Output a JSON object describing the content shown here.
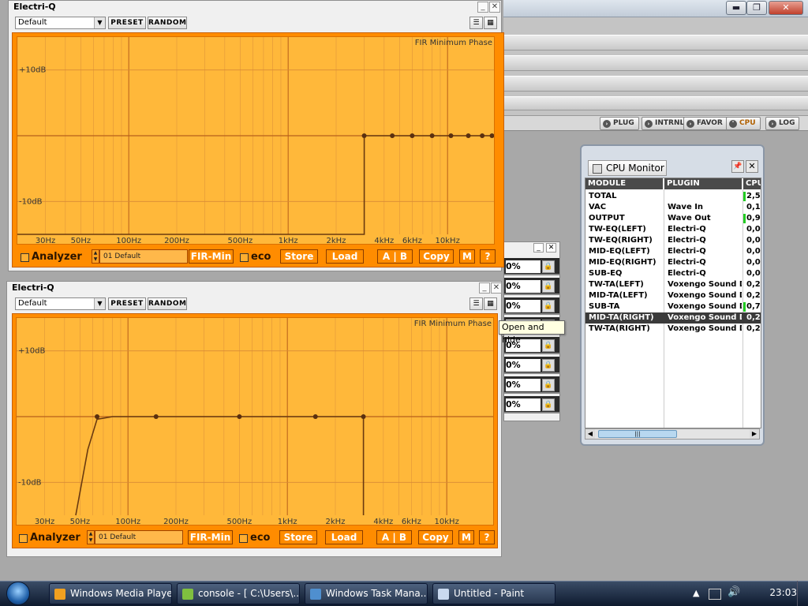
{
  "host": {
    "window_buttons": [
      "▬",
      "❐",
      "✕"
    ],
    "nav": [
      {
        "label": "PLUG",
        "icon": "arrow-icon"
      },
      {
        "label": "INTRNL",
        "icon": "arrow-icon"
      },
      {
        "label": "FAVOR",
        "icon": "arrow-icon"
      },
      {
        "label": "CPU",
        "icon": "down-arrow-icon",
        "active": true
      },
      {
        "label": "LOG",
        "icon": "arrow-icon"
      }
    ]
  },
  "eq1": {
    "title": "Electri-Q",
    "preset": "Default",
    "preset_btn": "PRESET",
    "random_btn": "RANDOM",
    "phase": "FIR Minimum Phase",
    "analyzer": "Analyzer",
    "program": "01  Default",
    "firmin": "FIR-Min",
    "eco": "eco",
    "store": "Store",
    "load": "Load",
    "ab": "A | B",
    "copy": "Copy",
    "m": "M",
    "help": "?"
  },
  "eq2": {
    "title": "Electri-Q",
    "preset": "Default",
    "preset_btn": "PRESET",
    "random_btn": "RANDOM",
    "phase": "FIR Minimum Phase",
    "analyzer": "Analyzer",
    "program": "01  Default",
    "firmin": "FIR-Min",
    "eco": "eco",
    "store": "Store",
    "load": "Load",
    "ab": "A | B",
    "copy": "Copy",
    "m": "M",
    "help": "?"
  },
  "chart_data": [
    {
      "type": "line",
      "title": "",
      "y_labels": [
        "+10dB",
        "-10dB"
      ],
      "x_labels": [
        "30Hz",
        "50Hz",
        "100Hz",
        "200Hz",
        "500Hz",
        "1kHz",
        "2kHz",
        "4kHz",
        "6kHz",
        "10kHz"
      ],
      "x_scale": "log",
      "xlim": [
        20,
        20000
      ],
      "ylim": [
        -15,
        15
      ],
      "grid": true,
      "curve": [
        [
          20,
          -15
        ],
        [
          3000,
          -15
        ],
        [
          3000,
          0
        ],
        [
          20000,
          0
        ]
      ],
      "points": [
        [
          3000,
          0
        ],
        [
          4500,
          0
        ],
        [
          6000,
          0
        ],
        [
          8000,
          0
        ],
        [
          10500,
          0
        ],
        [
          13500,
          0
        ],
        [
          16500,
          0
        ],
        [
          19000,
          0
        ]
      ]
    },
    {
      "type": "line",
      "title": "",
      "y_labels": [
        "+10dB",
        "-10dB"
      ],
      "x_labels": [
        "30Hz",
        "50Hz",
        "100Hz",
        "200Hz",
        "500Hz",
        "1kHz",
        "2kHz",
        "4kHz",
        "6kHz",
        "10kHz"
      ],
      "x_scale": "log",
      "xlim": [
        20,
        20000
      ],
      "ylim": [
        -15,
        15
      ],
      "grid": true,
      "curve": [
        [
          47,
          -15
        ],
        [
          56,
          -5
        ],
        [
          64,
          -0.4
        ],
        [
          80,
          0
        ],
        [
          3000,
          0
        ],
        [
          3000,
          -15
        ]
      ],
      "points": [
        [
          64,
          0
        ],
        [
          150,
          0
        ],
        [
          500,
          0
        ],
        [
          1500,
          0
        ],
        [
          3000,
          0
        ]
      ]
    }
  ],
  "tooltip": "Open and hide",
  "mid_window": {
    "rows": [
      "0%",
      "0%",
      "0%",
      "0%",
      "0%",
      "0%",
      "0%",
      "0%"
    ]
  },
  "cpu_monitor": {
    "title": "CPU Monitor",
    "headers": [
      "MODULE",
      "PLUGIN",
      "CPU"
    ],
    "rows": [
      {
        "module": "TOTAL",
        "plugin": "",
        "cpu": "2,5",
        "bar": true
      },
      {
        "module": "VAC",
        "plugin": "Wave In",
        "cpu": "0,1"
      },
      {
        "module": "OUTPUT",
        "plugin": "Wave Out",
        "cpu": "0,9",
        "bar": true
      },
      {
        "module": "TW-EQ(LEFT)",
        "plugin": "Electri-Q",
        "cpu": "0,0"
      },
      {
        "module": "TW-EQ(RIGHT)",
        "plugin": "Electri-Q",
        "cpu": "0,0"
      },
      {
        "module": "MID-EQ(LEFT)",
        "plugin": "Electri-Q",
        "cpu": "0,0"
      },
      {
        "module": "MID-EQ(RIGHT)",
        "plugin": "Electri-Q",
        "cpu": "0,0"
      },
      {
        "module": "SUB-EQ",
        "plugin": "Electri-Q",
        "cpu": "0,0"
      },
      {
        "module": "TW-TA(LEFT)",
        "plugin": "Voxengo Sound De",
        "cpu": "0,2"
      },
      {
        "module": "MID-TA(LEFT)",
        "plugin": "Voxengo Sound De",
        "cpu": "0,2"
      },
      {
        "module": "SUB-TA",
        "plugin": "Voxengo Sound De",
        "cpu": "0,7",
        "bar": true
      },
      {
        "module": "MID-TA(RIGHT)",
        "plugin": "Voxengo Sound De",
        "cpu": "0,2",
        "selected": true
      },
      {
        "module": "TW-TA(RIGHT)",
        "plugin": "Voxengo Sound De",
        "cpu": "0,2"
      }
    ]
  },
  "taskbar": {
    "items": [
      {
        "label": "Windows Media Player",
        "color": "#f0a020"
      },
      {
        "label": "console - [ C:\\Users\\...",
        "color": "#7fbf3f"
      },
      {
        "label": "Windows Task Mana...",
        "color": "#4f8fcf"
      },
      {
        "label": "Untitled - Paint",
        "color": "#c9d9ef"
      }
    ],
    "clock": "23:03"
  }
}
